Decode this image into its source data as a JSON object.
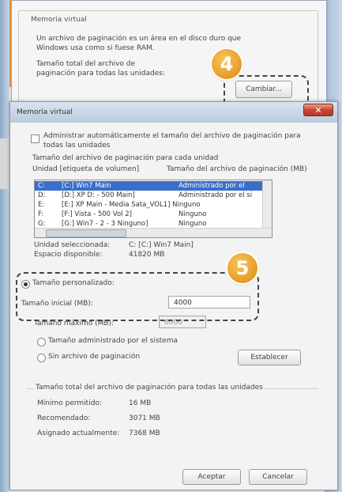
{
  "background_dialog": {
    "group_title": "Memoria virtual",
    "description_line1": "Un archivo de paginación es un área en el disco duro que",
    "description_line2": "Windows usa como si fuese RAM.",
    "total_line1": "Tamaño total del archivo de",
    "total_line2": "paginación para todas las unidades:",
    "change_button": "Cambiar..."
  },
  "markers": {
    "step4": "4",
    "step5": "5"
  },
  "dialog": {
    "title": "Memoria virtual",
    "close_glyph": "✕",
    "auto_manage_label_line1": "Administrar automáticamente el tamaño del archivo de paginación para",
    "auto_manage_label_line2": "todas las unidades",
    "list_caption": "Tamaño del archivo de paginación para cada unidad",
    "col_drive": "Unidad [etiqueta de volumen]",
    "col_size": "Tamaño del archivo de paginación (MB)",
    "drives": [
      {
        "letter": "C:",
        "label": "[C:] Win7 Main",
        "size": "Administrado por el",
        "selected": true
      },
      {
        "letter": "D:",
        "label": "[D:] XP D: - 500 Main]",
        "size": "Administrado por el si",
        "selected": false
      },
      {
        "letter": "E:",
        "label": "[E:] XP Main - Media Sata_VOL1] Ninguno",
        "size": "",
        "selected": false
      },
      {
        "letter": "F:",
        "label": "[F:] Vista - 500 Vol 2]",
        "size": "Ninguno",
        "selected": false
      },
      {
        "letter": "G:",
        "label": "[G:] Win7 - 2 - 3 Ninguno]",
        "size": "Ninguno",
        "selected": false
      }
    ],
    "selected_drive_label": "Unidad seleccionada:",
    "selected_drive_value": "C:  [C:] Win7 Main]",
    "space_available_label": "Espacio disponible:",
    "space_available_value": "41820 MB",
    "custom_size_label": "Tamaño personalizado:",
    "initial_size_label": "Tamaño inicial (MB):",
    "initial_size_value": "4000",
    "max_size_label": "Tamaño máximo (MB):",
    "max_size_value": "6000",
    "system_managed_label": "Tamaño administrado por el sistema",
    "no_paging_label": "Sin archivo de paginación",
    "set_button": "Establecer",
    "totals_caption": "Tamaño total del archivo de paginación para todas las unidades",
    "min_allowed_label": "Mínimo permitido:",
    "min_allowed_value": "16 MB",
    "recommended_label": "Recomendado:",
    "recommended_value": "3071 MB",
    "current_allocated_label": "Asignado actualmente:",
    "current_allocated_value": "7368 MB",
    "accept_button": "Aceptar",
    "cancel_button": "Cancelar"
  }
}
